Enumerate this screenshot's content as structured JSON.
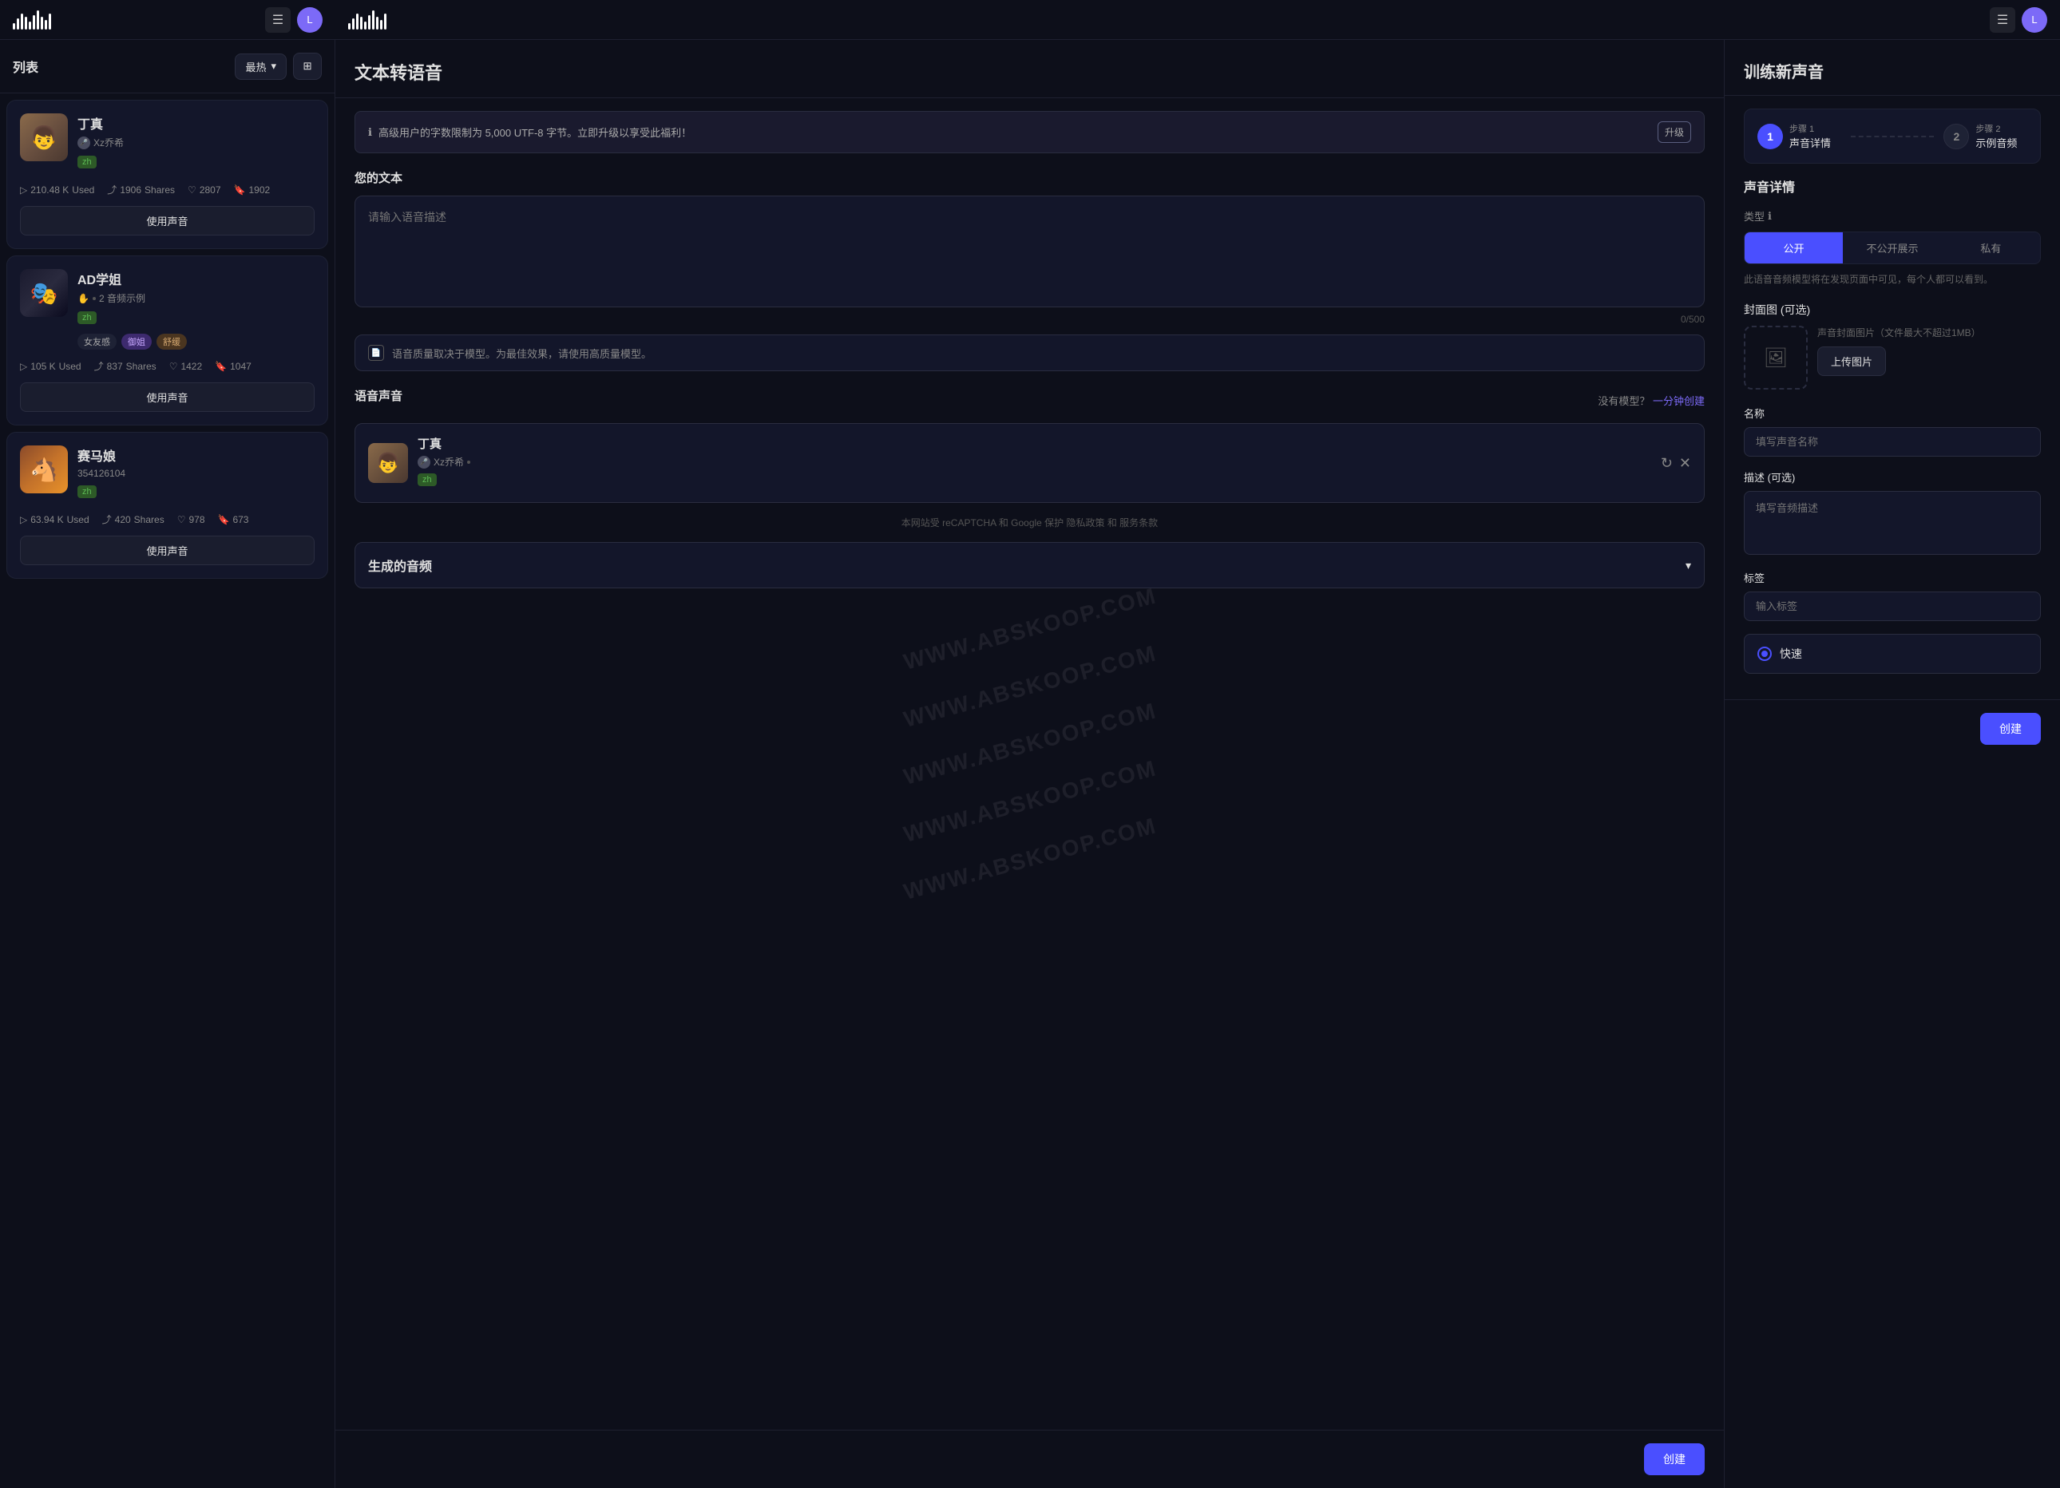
{
  "app": {
    "logo_alt": "VoiceAI Logo",
    "menu_icon": "☰",
    "user_initial": "L"
  },
  "voice_list": {
    "title": "列表",
    "sort_label": "最热",
    "filter_icon": "⊞",
    "voices": [
      {
        "id": "dingzhen",
        "name": "丁真",
        "creator": "Xz乔希",
        "lang": "zh",
        "play_count": "210.48 K",
        "play_label": "Used",
        "shares": "1906",
        "shares_label": "Shares",
        "likes": "2807",
        "bookmarks": "1902",
        "btn_label": "使用声音",
        "tags": [],
        "avatar_emoji": "👦"
      },
      {
        "id": "ad-jiejie",
        "name": "AD学姐",
        "creator": "",
        "lang": "zh",
        "audio_samples": "2 音频示例",
        "play_count": "105 K",
        "play_label": "Used",
        "shares": "837",
        "shares_label": "Shares",
        "likes": "1422",
        "bookmarks": "1047",
        "btn_label": "使用声音",
        "tags": [
          "女友感",
          "御姐",
          "舒缓"
        ],
        "avatar_emoji": "🎭"
      },
      {
        "id": "racing-girl",
        "name": "赛马娘",
        "creator": "354126104",
        "lang": "zh",
        "play_count": "63.94 K",
        "play_label": "Used",
        "shares": "420",
        "shares_label": "Shares",
        "likes": "978",
        "bookmarks": "673",
        "btn_label": "使用声音",
        "tags": [],
        "avatar_emoji": "🐴"
      }
    ]
  },
  "tts": {
    "title": "文本转语音",
    "upgrade_notice": "高级用户的字数限制为 5,000 UTF-8 字节。立即升级以享受此福利！",
    "upgrade_btn": "升级",
    "your_text_label": "您的文本",
    "text_placeholder": "请输入语音描述",
    "char_count": "0/500",
    "quality_notice": "语音质量取决于模型。为最佳效果，请使用高质量模型。",
    "voice_sound_label": "语音声音",
    "no_model_text": "没有模型？",
    "create_link": "一分钟创建",
    "selected_voice": {
      "name": "丁真",
      "creator": "Xz乔希",
      "lang": "zh",
      "avatar_emoji": "👦"
    },
    "privacy_text": "本网站受 reCAPTCHA 和 Google 保护 隐私政策 和 服务条款",
    "generated_audio_label": "生成的音频",
    "create_btn": "创建"
  },
  "train": {
    "title": "训练新声音",
    "steps": [
      {
        "number": "1",
        "step_label": "步骤 1",
        "step_name": "声音详情",
        "active": true
      },
      {
        "number": "2",
        "step_label": "步骤 2",
        "step_name": "示例音频",
        "active": false
      }
    ],
    "section_title": "声音详情",
    "type_label": "类型",
    "type_options": [
      "公开",
      "不公开展示",
      "私有"
    ],
    "active_type": "公开",
    "type_description": "此语音音频模型将在发现页面中可见，每个人都可以看到。",
    "cover_label": "封面图 (可选)",
    "cover_desc": "声音封面图片（文件最大不超过1MB）",
    "upload_btn": "上传图片",
    "name_label": "名称",
    "name_placeholder": "填写声音名称",
    "desc_label": "描述 (可选)",
    "desc_placeholder": "填写音频描述",
    "tags_label": "标签",
    "tags_placeholder": "输入标签",
    "speed_option": "快速",
    "create_btn": "创建"
  },
  "watermark": "WWW.ABSKOOP.COM"
}
